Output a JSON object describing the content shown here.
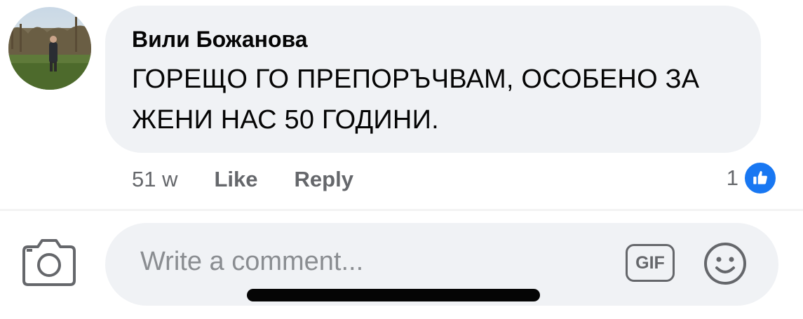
{
  "comment": {
    "author": "Вили Божанова",
    "text": "ГОРЕЩО ГО ПРЕПОРЪЧВАМ, ОСОБЕНО ЗА ЖЕНИ НАС 50 ГОДИНИ.",
    "timestamp": "51 w",
    "like_label": "Like",
    "reply_label": "Reply",
    "reaction_count": "1",
    "reaction_icon": "thumbs-up-icon"
  },
  "composer": {
    "placeholder": "Write a comment...",
    "gif_label": "GIF",
    "camera_icon": "camera-icon",
    "emoji_icon": "smiley-icon"
  },
  "colors": {
    "bubble_bg": "#f0f2f5",
    "secondary_text": "#65676b",
    "like_blue": "#1877f2"
  }
}
